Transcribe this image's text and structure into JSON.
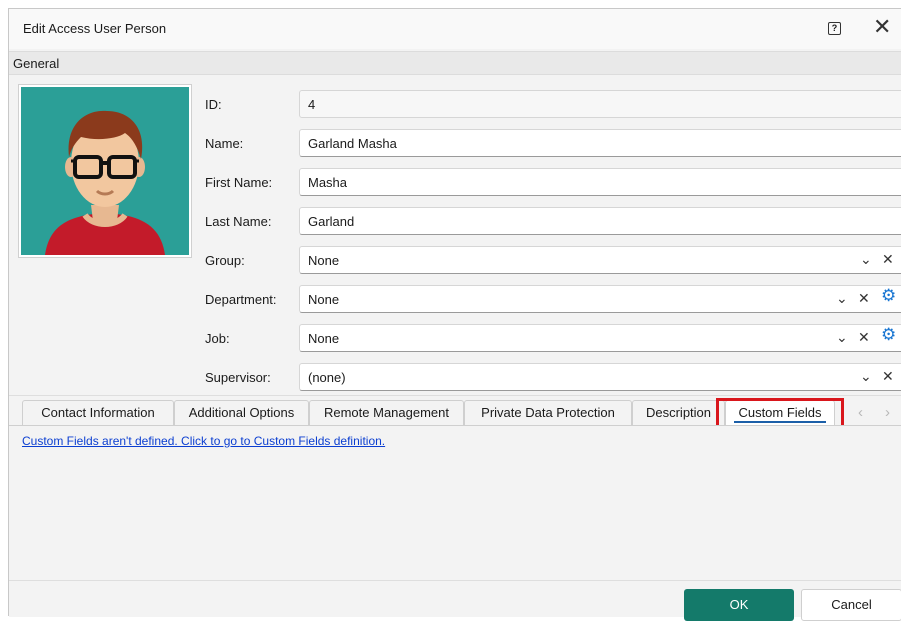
{
  "window": {
    "title": "Edit Access User Person",
    "help_glyph": "?",
    "close_glyph": "✕"
  },
  "section": {
    "title": "General"
  },
  "fields": {
    "id": {
      "label": "ID:",
      "value": "4"
    },
    "name": {
      "label": "Name:",
      "value": "Garland Masha"
    },
    "first_name": {
      "label": "First Name:",
      "value": "Masha"
    },
    "last_name": {
      "label": "Last Name:",
      "value": "Garland"
    },
    "group": {
      "label": "Group:",
      "value": "None"
    },
    "department": {
      "label": "Department:",
      "value": "None"
    },
    "job": {
      "label": "Job:",
      "value": "None"
    },
    "supervisor": {
      "label": "Supervisor:",
      "value": "(none)"
    }
  },
  "glyphs": {
    "dropdown": "⌄",
    "clear": "✕",
    "gear": "⚙",
    "prev": "‹",
    "next": "›"
  },
  "tabs": [
    {
      "label": "Contact Information"
    },
    {
      "label": "Additional Options"
    },
    {
      "label": "Remote Management"
    },
    {
      "label": "Private Data Protection"
    },
    {
      "label": "Description"
    },
    {
      "label": "Custom Fields"
    }
  ],
  "active_tab": "Custom Fields",
  "custom_fields": {
    "link_text": "Custom Fields aren't defined. Click to go to Custom Fields definition."
  },
  "footer": {
    "ok_label": "OK",
    "cancel_label": "Cancel"
  },
  "colors": {
    "accent": "#147a6a",
    "highlight": "#d9161c",
    "link": "#0b3ed1",
    "gear": "#1976d2"
  }
}
